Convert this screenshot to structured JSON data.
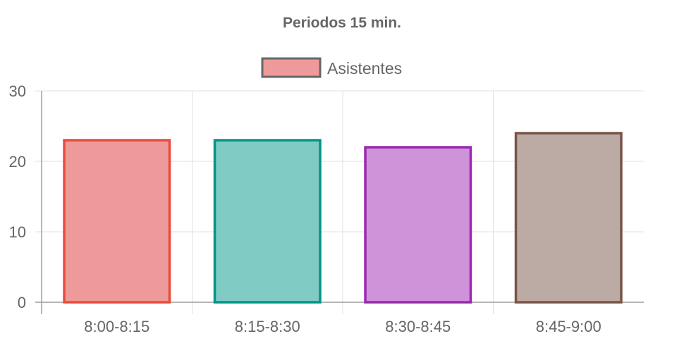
{
  "chart_data": {
    "type": "bar",
    "title": "Periodos 15 min.",
    "xlabel": "",
    "ylabel": "",
    "categories": [
      "8:00-8:15",
      "8:15-8:30",
      "8:30-8:45",
      "8:45-9:00"
    ],
    "series": [
      {
        "name": "Asistentes",
        "values": [
          23,
          23,
          22,
          24
        ]
      }
    ],
    "bar_fill_colors": [
      "#ef9a9a",
      "#80cbc4",
      "#ce93d8",
      "#bcaaa4"
    ],
    "bar_border_colors": [
      "#e74c3c",
      "#009688",
      "#9c27b0",
      "#795548"
    ],
    "legend_fill_color": "#ef9a9a",
    "legend_border_color": "#666666",
    "ylim": [
      0,
      30
    ],
    "yticks": [
      0,
      10,
      20,
      30
    ],
    "grid": true,
    "legend_position": "top"
  }
}
